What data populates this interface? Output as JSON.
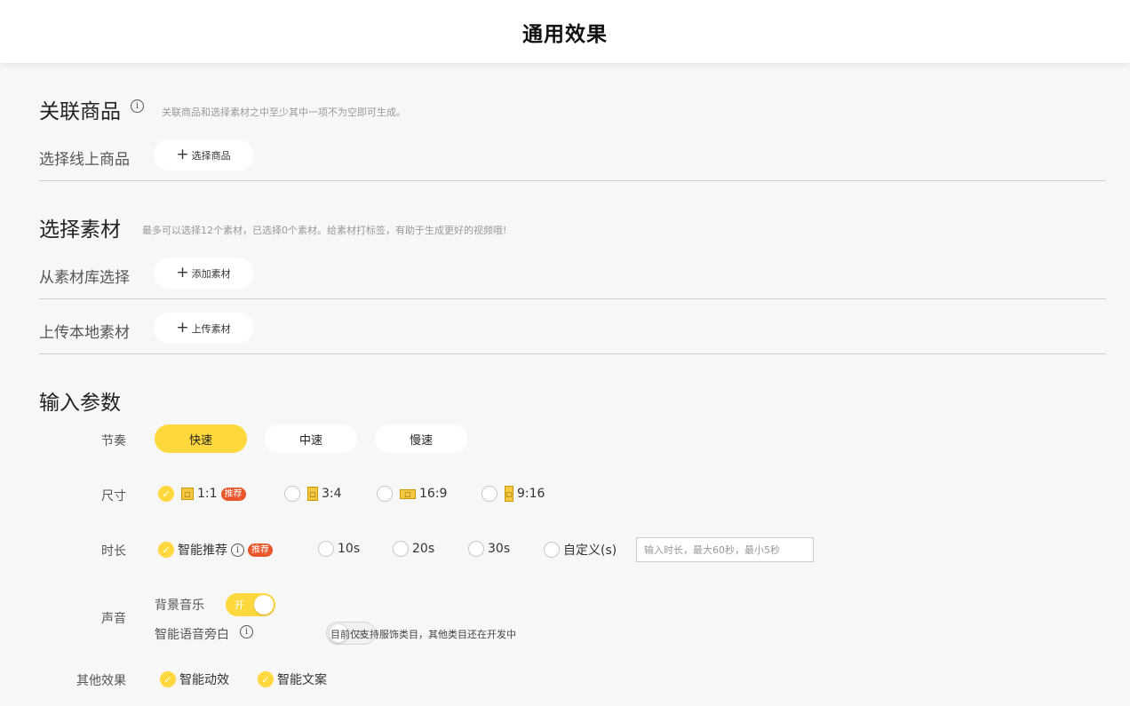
{
  "header": {
    "title": "通用效果"
  },
  "linked_products": {
    "title": "关联商品",
    "hint": "关联商品和选择素材之中至少其中一项不为空即可生成。",
    "online_label": "选择线上商品",
    "select_button": "选择商品"
  },
  "materials": {
    "title": "选择素材",
    "hint": "最多可以选择12个素材，已选择0个素材。给素材打标签，有助于生成更好的视频哦!",
    "library_label": "从素材库选择",
    "add_button": "添加素材",
    "local_label": "上传本地素材",
    "upload_button": "上传素材"
  },
  "params": {
    "title": "输入参数",
    "rhythm": {
      "label": "节奏",
      "options": [
        "快速",
        "中速",
        "慢速"
      ],
      "selected": "快速"
    },
    "size": {
      "label": "尺寸",
      "options": [
        "1:1",
        "3:4",
        "16:9",
        "9:16"
      ],
      "selected": "1:1",
      "badge": "推荐"
    },
    "duration": {
      "label": "时长",
      "smart": "智能推荐",
      "badge": "推荐",
      "options": [
        "10s",
        "20s",
        "30s",
        "自定义(s)"
      ],
      "placeholder": "输入时长，最大60秒，最小5秒"
    },
    "sound": {
      "label": "声音",
      "bgm_label": "背景音乐",
      "bgm_state": "开",
      "voice_label": "智能语音旁白",
      "voice_state": "关",
      "voice_note": "目前仅支持服饰类目，其他类目还在开发中"
    },
    "other": {
      "label": "其他效果",
      "options": [
        "智能动效",
        "智能文案"
      ]
    }
  },
  "colors": {
    "accent": "#ffd83d",
    "badge": "#e8562a"
  },
  "icons": {
    "info": "info-icon",
    "plus": "plus-icon",
    "check": "check-icon"
  }
}
